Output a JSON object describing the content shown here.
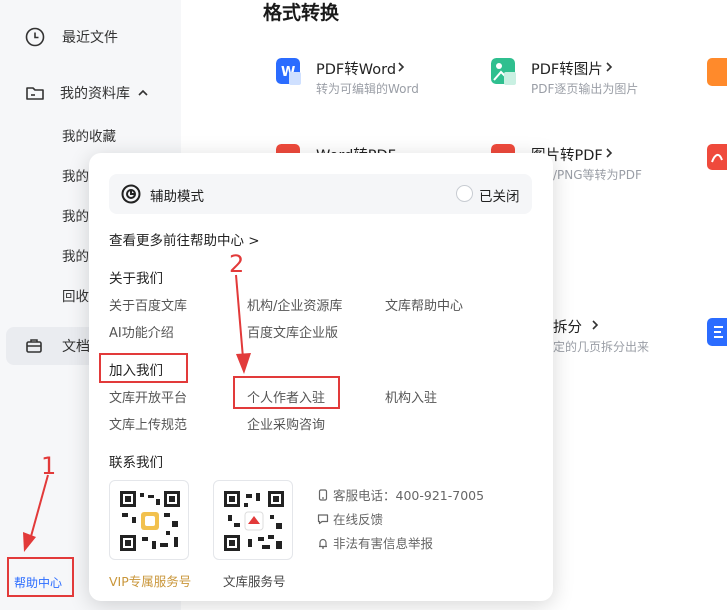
{
  "sidebar": {
    "recent": "最近文件",
    "library": "我的资料库",
    "favorites": "我的收藏",
    "partial_items": [
      "我的",
      "我的",
      "我的"
    ],
    "recycle": "回收",
    "docs": "文档",
    "help_center": "帮助中心"
  },
  "main": {
    "title": "格式转换",
    "tools": [
      {
        "name": "PDF转Word",
        "desc": "转为可编辑的Word",
        "icon": "word-icon",
        "color": "#2b6cff"
      },
      {
        "name": "PDF转图片",
        "desc": "PDF逐页输出为图片",
        "icon": "image-icon",
        "color": "#2fbf8f"
      },
      {
        "name": "Word转PDF",
        "desc": "",
        "icon": "pdf-icon",
        "color": "#ef4a3c"
      },
      {
        "name": "图片转PDF",
        "desc": "/PNG等转为PDF",
        "icon": "pdf-icon",
        "color": "#ef4a3c"
      },
      {
        "name": "拆分",
        "desc": "定的几页拆分出来",
        "icon": "split-icon",
        "color": "#2b6cff"
      }
    ]
  },
  "popup": {
    "assist_mode": "辅助模式",
    "assist_status": "已关闭",
    "more_help": "查看更多前往帮助中心 >",
    "about": {
      "title": "关于我们",
      "links": [
        "关于百度文库",
        "机构/企业资源库",
        "文库帮助中心",
        "AI功能介绍",
        "百度文库企业版"
      ]
    },
    "join": {
      "title": "加入我们",
      "links": [
        "文库开放平台",
        "个人作者入驻",
        "机构入驻",
        "文库上传规范",
        "企业采购咨询"
      ]
    },
    "contact": {
      "title": "联系我们",
      "qr_vip": "VIP专属服务号",
      "qr_wenku": "文库服务号",
      "phone": "客服电话：400-921-7005",
      "feedback": "在线反馈",
      "report": "非法有害信息举报"
    }
  },
  "annotations": {
    "step1": "1",
    "step2": "2"
  },
  "colors": {
    "annotation": "#e23a3a",
    "link": "#2b6cff",
    "vip": "#c9963a"
  }
}
